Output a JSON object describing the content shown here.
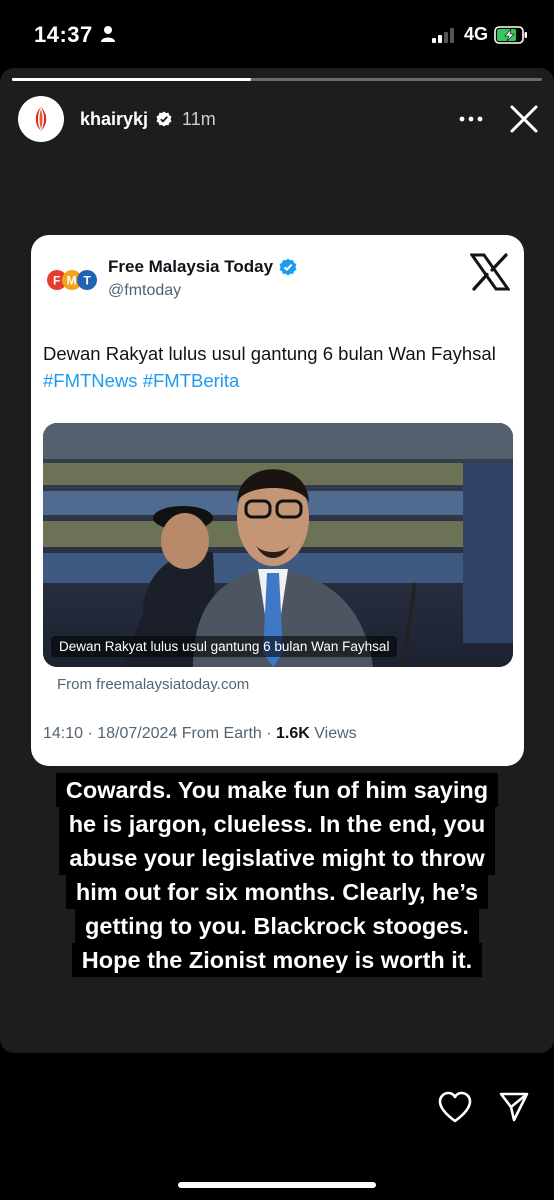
{
  "status_bar": {
    "time": "14:37",
    "network": "4G",
    "signal_bars_active": 2,
    "signal_bars_total": 4,
    "battery_state": "charging"
  },
  "story": {
    "progress_fraction": 0.45,
    "username": "khairykj",
    "verified": true,
    "time_ago": "11m"
  },
  "tweet": {
    "author_name": "Free Malaysia Today",
    "handle": "@fmtoday",
    "logo_text": "FMT",
    "body_text": "Dewan Rakyat lulus usul gantung 6 bulan Wan Fayhsal ",
    "hashtags": "#FMTNews #FMTBerita",
    "image_caption": "Dewan Rakyat lulus usul gantung 6 bulan Wan Fayhsal",
    "link_source": "From freemalaysiatoday.com",
    "timestamp": "14:10 · 18/07/2024 From Earth · ",
    "views_count": "1.6K",
    "views_label": " Views",
    "accent_color": "#1d9bf0"
  },
  "overlay": {
    "lines": [
      "Cowards. You make fun of him saying",
      "he is jargon, clueless. In the end, you",
      "abuse your legislative might to throw",
      "him out for six months. Clearly, he’s",
      "getting to you. Blackrock stooges.",
      "Hope the Zionist money is worth it."
    ]
  },
  "icons": {
    "status_person": "person-icon",
    "battery": "battery-charging-icon",
    "verified": "verified-badge-icon",
    "more": "more-dots-icon",
    "close": "close-icon",
    "x_logo": "x-logo-icon",
    "like": "heart-icon",
    "share": "send-icon"
  }
}
